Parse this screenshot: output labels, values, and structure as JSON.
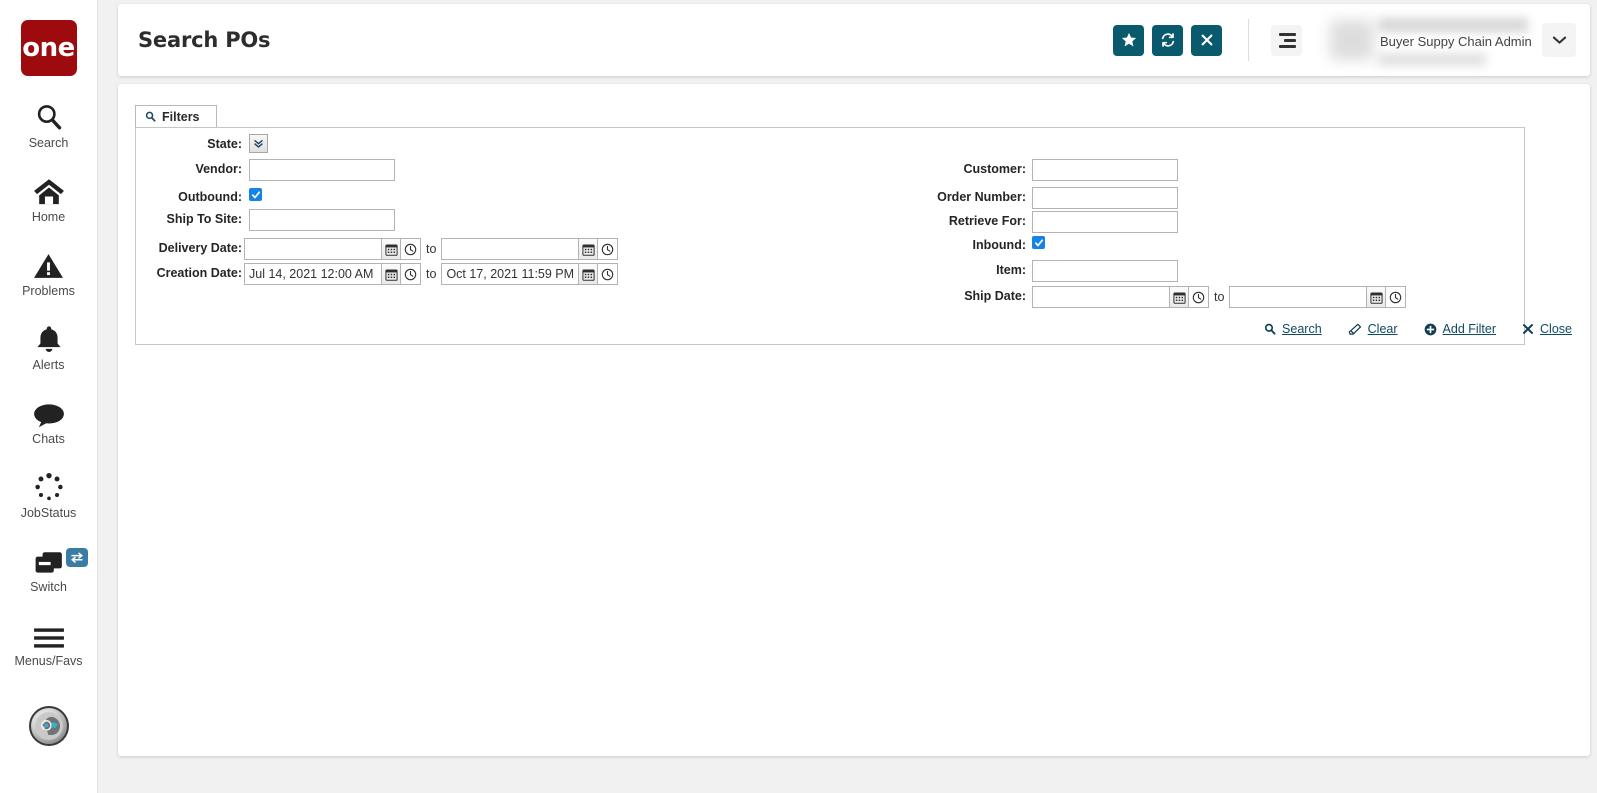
{
  "brand": {
    "logo_text": "one",
    "logo_color": "#9e0b0f"
  },
  "theme": {
    "accent_teal": "#0a5a6e",
    "link": "#0f4b63",
    "checkbox_blue": "#1583e8"
  },
  "sidebar": {
    "items": [
      {
        "icon": "search-icon",
        "label": "Search"
      },
      {
        "icon": "home-icon",
        "label": "Home"
      },
      {
        "icon": "problems-warning-icon",
        "label": "Problems"
      },
      {
        "icon": "alerts-bell-icon",
        "label": "Alerts"
      },
      {
        "icon": "chats-bubble-icon",
        "label": "Chats"
      },
      {
        "icon": "jobstatus-spinner-icon",
        "label": "JobStatus"
      },
      {
        "icon": "switch-windows-icon",
        "label": "Switch"
      },
      {
        "icon": "menus-favs-hamburger-icon",
        "label": "Menus/Favs"
      }
    ],
    "profile_avatar": "user-avatar-icon"
  },
  "header": {
    "title": "Search POs",
    "buttons": [
      {
        "icon": "star-icon",
        "name": "favorite-button"
      },
      {
        "icon": "refresh-icon",
        "name": "refresh-button"
      },
      {
        "icon": "close-x-icon",
        "name": "close-button"
      }
    ],
    "menu_icon": "hamburger-menu-icon",
    "user_role": "Buyer Suppy Chain Admin",
    "caret_icon": "chevron-down-icon"
  },
  "filters": {
    "tab_label": "Filters",
    "tab_icon": "search-icon",
    "left": {
      "state_label": "State:",
      "state_icon": "double-chevron-down-icon",
      "vendor_label": "Vendor:",
      "vendor_value": "",
      "outbound_label": "Outbound:",
      "outbound_checked": true,
      "ship_to_site_label": "Ship To Site:",
      "ship_to_site_value": "",
      "delivery_date_label": "Delivery Date:",
      "delivery_date_from": "",
      "delivery_date_to": "",
      "creation_date_label": "Creation Date:",
      "creation_date_from": "Jul 14, 2021 12:00 AM",
      "creation_date_to": "Oct 17, 2021 11:59 PM",
      "to_word": "to"
    },
    "right": {
      "customer_label": "Customer:",
      "customer_value": "",
      "order_number_label": "Order Number:",
      "order_number_value": "",
      "retrieve_for_label": "Retrieve For:",
      "retrieve_for_value": "",
      "inbound_label": "Inbound:",
      "inbound_checked": true,
      "item_label": "Item:",
      "item_value": "",
      "ship_date_label": "Ship Date:",
      "ship_date_from": "",
      "ship_date_to": "",
      "to_word": "to"
    },
    "actions": [
      {
        "icon": "search-icon",
        "label": "Search"
      },
      {
        "icon": "eraser-icon",
        "label": "Clear"
      },
      {
        "icon": "plus-circle-icon",
        "label": "Add Filter"
      },
      {
        "icon": "close-x-icon",
        "label": "Close"
      }
    ]
  }
}
